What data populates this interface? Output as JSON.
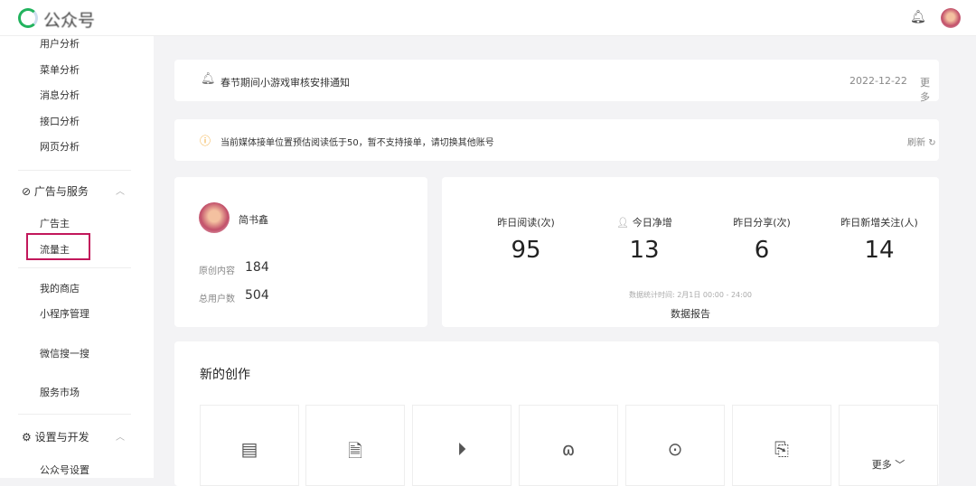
{
  "header": {
    "app_title": "公众号",
    "bell_icon": "bell-icon"
  },
  "sidebar": {
    "group1": [
      "用户分析",
      "菜单分析",
      "消息分析",
      "接口分析",
      "网页分析"
    ],
    "ads_header": "广告与服务",
    "ads_items": [
      "广告主",
      "流量主"
    ],
    "misc_items": [
      "我的商店",
      "小程序管理",
      "微信搜一搜",
      "服务市场"
    ],
    "settings_header": "设置与开发",
    "settings_items": [
      "公众号设置"
    ]
  },
  "notice": {
    "text": "春节期间小游戏审核安排通知",
    "date": "2022-12-22",
    "more": "更多"
  },
  "warning": {
    "text": "当前媒体接单位置预估阅读低于50，暂不支持接单，请切换其他账号",
    "refresh": "刷新",
    "accent": "#f0a020"
  },
  "account": {
    "name": "简书鑫",
    "original_label": "原创内容",
    "original_value": "184",
    "users_label": "总用户数",
    "users_value": "504"
  },
  "stats": {
    "items": [
      {
        "label": "昨日阅读(次)",
        "value": "95"
      },
      {
        "label": "今日净增",
        "value": "13"
      },
      {
        "label": "昨日分享(次)",
        "value": "6"
      },
      {
        "label": "昨日新增关注(人)",
        "value": "14"
      }
    ],
    "time_note": "数据统计时间: 2月1日 00:00 - 24:00",
    "report": "数据报告"
  },
  "create": {
    "title": "新的创作",
    "more": "更多"
  }
}
